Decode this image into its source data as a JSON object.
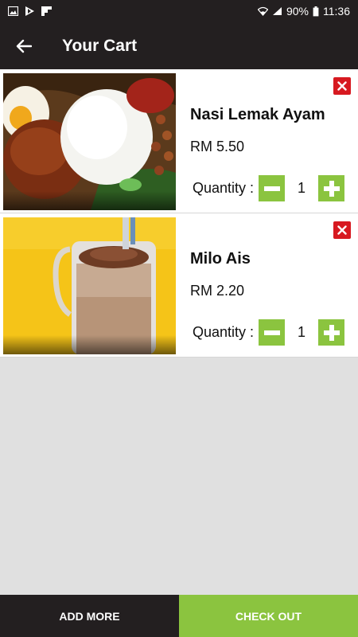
{
  "status_bar": {
    "battery": "90%",
    "time": "11:36",
    "icons": [
      "gallery-icon",
      "play-store-icon",
      "flipboard-icon",
      "wifi-icon",
      "signal-icon",
      "battery-icon"
    ]
  },
  "app_bar": {
    "back_icon": "arrow-left-icon",
    "title": "Your Cart"
  },
  "cart": {
    "items": [
      {
        "name": "Nasi Lemak Ayam",
        "price": "RM 5.50",
        "quantity_label": "Quantity :",
        "quantity": "1",
        "image": "nasi-lemak-photo"
      },
      {
        "name": "Milo Ais",
        "price": "RM 2.20",
        "quantity_label": "Quantity :",
        "quantity": "1",
        "image": "milo-ais-photo"
      }
    ]
  },
  "bottom_bar": {
    "add_more_label": "ADD MORE",
    "checkout_label": "CHECK OUT"
  },
  "colors": {
    "bar_dark": "#231f20",
    "accent_green": "#8bc43f",
    "remove_red": "#d71920",
    "background": "#e0e0e0"
  }
}
